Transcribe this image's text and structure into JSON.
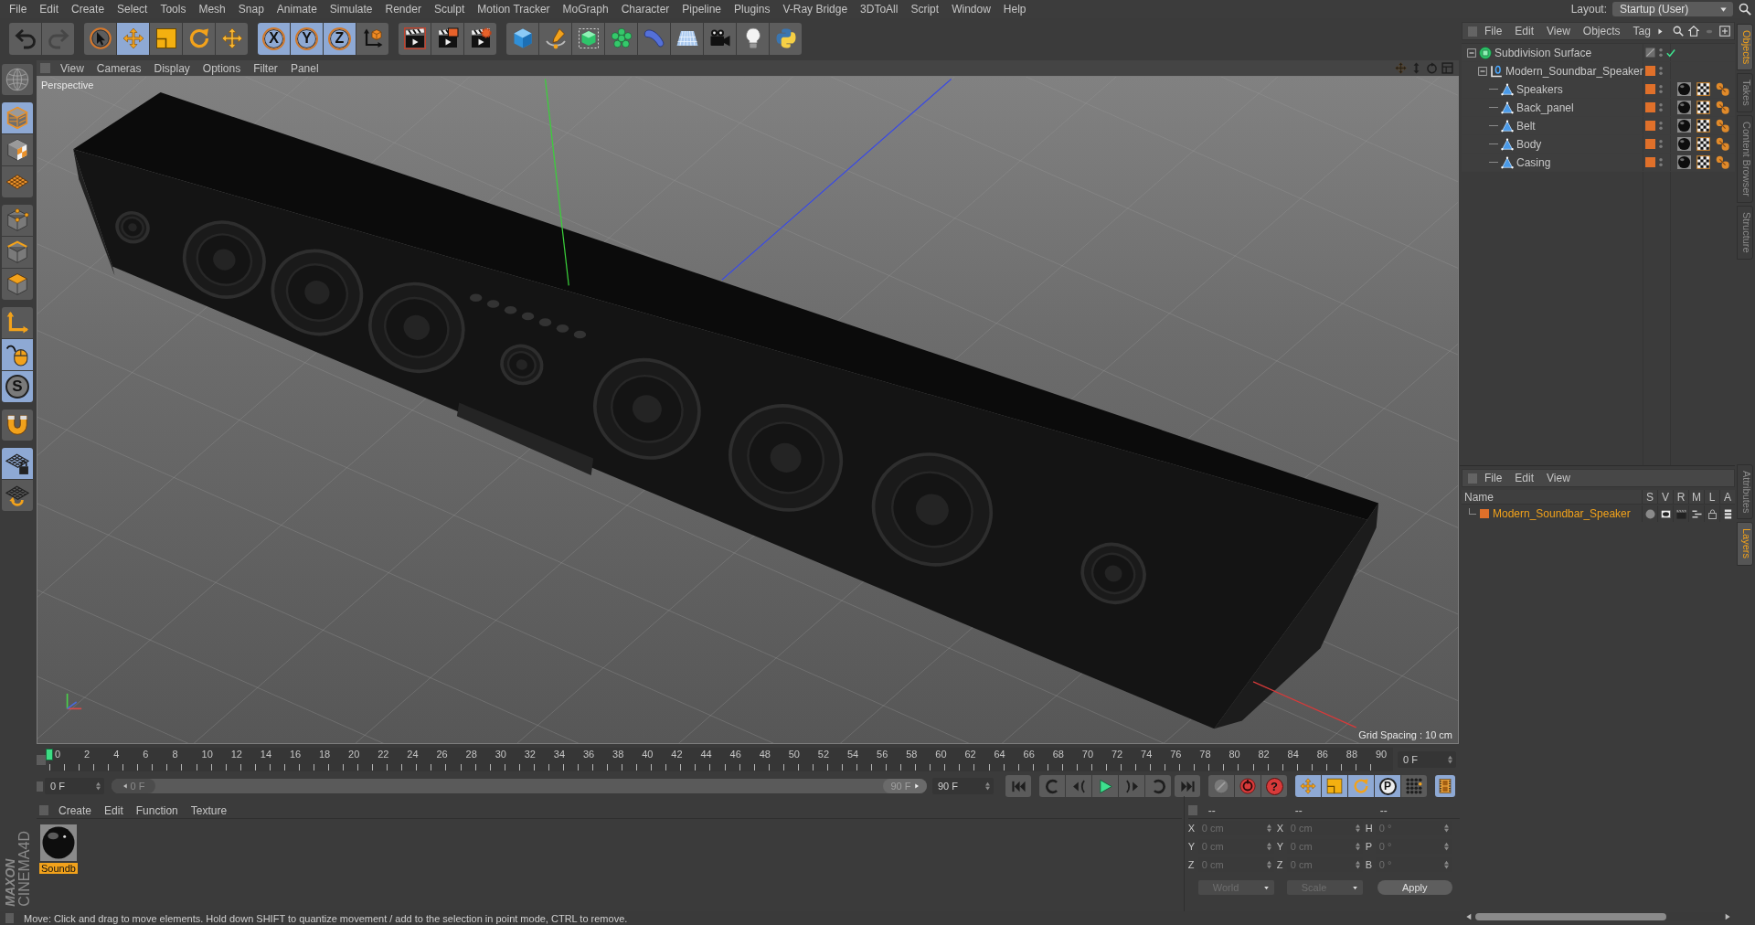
{
  "menu_bar": {
    "items": [
      "File",
      "Edit",
      "Create",
      "Select",
      "Tools",
      "Mesh",
      "Snap",
      "Animate",
      "Simulate",
      "Render",
      "Sculpt",
      "Motion Tracker",
      "MoGraph",
      "Character",
      "Pipeline",
      "Plugins",
      "V-Ray Bridge",
      "3DToAll",
      "Script",
      "Window",
      "Help"
    ],
    "layout_label": "Layout:",
    "layout_value": "Startup (User)"
  },
  "main_toolbar": [
    [
      {
        "kind": "undo",
        "disabled": false
      },
      {
        "kind": "redo",
        "disabled": true
      }
    ],
    [
      {
        "kind": "select",
        "active": false
      },
      {
        "kind": "move",
        "active": true
      },
      {
        "kind": "scale",
        "active": false
      },
      {
        "kind": "rotate",
        "active": false
      },
      {
        "kind": "recent",
        "active": false
      }
    ],
    [
      {
        "kind": "axis",
        "label": "X",
        "active": true
      },
      {
        "kind": "axis",
        "label": "Y",
        "active": true
      },
      {
        "kind": "axis",
        "label": "Z",
        "active": true
      },
      {
        "kind": "coords",
        "active": false
      }
    ],
    [
      {
        "kind": "render_view"
      },
      {
        "kind": "render_picture"
      },
      {
        "kind": "render_settings"
      }
    ],
    [
      {
        "kind": "cube"
      },
      {
        "kind": "pen"
      },
      {
        "kind": "subdivision"
      },
      {
        "kind": "cloner"
      },
      {
        "kind": "deformer"
      },
      {
        "kind": "floor"
      },
      {
        "kind": "camera"
      },
      {
        "kind": "light"
      },
      {
        "kind": "script"
      }
    ]
  ],
  "side_toolbar": [
    [
      {
        "kind": "make_editable",
        "active": false
      }
    ],
    [
      {
        "kind": "model",
        "active": true
      },
      {
        "kind": "texture",
        "active": false
      },
      {
        "kind": "workplane",
        "active": false
      }
    ],
    [
      {
        "kind": "points",
        "active": false
      },
      {
        "kind": "edges",
        "active": false
      },
      {
        "kind": "polygons",
        "active": false
      }
    ],
    [
      {
        "kind": "axis",
        "active": false
      },
      {
        "kind": "tweak",
        "active": true
      },
      {
        "kind": "snap",
        "label": "S",
        "active": true
      }
    ],
    [
      {
        "kind": "magnet",
        "active": false
      }
    ],
    [
      {
        "kind": "grid_lock",
        "active": true
      },
      {
        "kind": "grid_rotate",
        "active": false
      }
    ]
  ],
  "logo": {
    "brand": "MAXON",
    "product": "CINEMA4D"
  },
  "viewport": {
    "menu": [
      "View",
      "Cameras",
      "Display",
      "Options",
      "Filter",
      "Panel"
    ],
    "camera": "Perspective",
    "grid_spacing": "Grid Spacing : 10 cm"
  },
  "timeline": {
    "frames": [
      "0",
      "2",
      "4",
      "6",
      "8",
      "10",
      "12",
      "14",
      "16",
      "18",
      "20",
      "22",
      "24",
      "26",
      "28",
      "30",
      "32",
      "34",
      "36",
      "38",
      "40",
      "42",
      "44",
      "46",
      "48",
      "50",
      "52",
      "54",
      "56",
      "58",
      "60",
      "62",
      "64",
      "66",
      "68",
      "70",
      "72",
      "74",
      "76",
      "78",
      "80",
      "82",
      "84",
      "86",
      "88",
      "90"
    ],
    "playhead": {
      "level": 0
    },
    "current_frame": "0 F",
    "start_frame": "0 F",
    "range_handles": [
      {
        "label": "0 F",
        "level": 0
      },
      {
        "label": "90 F",
        "level": 1
      }
    ],
    "end_frame": "90 F",
    "playback": [
      [
        {
          "kind": "first"
        }
      ],
      [
        {
          "kind": "prev_key"
        },
        {
          "kind": "prev_frame"
        },
        {
          "kind": "play"
        },
        {
          "kind": "next_frame"
        },
        {
          "kind": "next_key"
        }
      ],
      [
        {
          "kind": "last"
        }
      ]
    ],
    "keys": [
      {
        "kind": "record",
        "disabled": true
      },
      {
        "kind": "autokey",
        "disabled": false
      },
      {
        "kind": "keyset",
        "label": "?",
        "disabled": false
      }
    ],
    "key_filters": [
      {
        "kind": "move",
        "active": true
      },
      {
        "kind": "scale",
        "active": true
      },
      {
        "kind": "rotate",
        "active": true
      },
      {
        "kind": "param",
        "label": "P",
        "active": true
      },
      {
        "kind": "points",
        "active": false
      }
    ],
    "timeline_button": {
      "active": true
    }
  },
  "materials": {
    "menu": [
      "Create",
      "Edit",
      "Function",
      "Texture"
    ],
    "items": [
      {
        "name": "Soundb",
        "selected": true
      }
    ]
  },
  "coordinates": {
    "headers": [
      "--",
      "--",
      "--"
    ],
    "rows": [
      [
        {
          "axis": "X",
          "value": "0 cm"
        },
        {
          "axis": "X",
          "value": "0 cm"
        },
        {
          "axis": "H",
          "value": "0 °"
        }
      ],
      [
        {
          "axis": "Y",
          "value": "0 cm"
        },
        {
          "axis": "Y",
          "value": "0 cm"
        },
        {
          "axis": "P",
          "value": "0 °"
        }
      ],
      [
        {
          "axis": "Z",
          "value": "0 cm"
        },
        {
          "axis": "Z",
          "value": "0 cm"
        },
        {
          "axis": "B",
          "value": "0 °"
        }
      ]
    ],
    "mode": "World",
    "scale_mode": "Scale",
    "apply": "Apply"
  },
  "status_bar": "Move: Click and drag to move elements. Hold down SHIFT to quantize movement / add to the selection in point mode, CTRL to remove.",
  "objects": {
    "menu": [
      "File",
      "Edit",
      "View",
      "Objects",
      "Tag"
    ],
    "tree": [
      {
        "name": "Subdivision Surface",
        "kind": "subdivision",
        "selected": false,
        "layer": false,
        "enabled": true,
        "expanded": true,
        "children": [
          {
            "name": "Modern_Soundbar_Speaker",
            "kind": "null",
            "selected": false,
            "layer": true,
            "expanded": true,
            "children": [
              {
                "name": "Speakers",
                "kind": "polygon",
                "selected": false,
                "layer": true,
                "tags": [
                  {
                    "kind": "material"
                  },
                  {
                    "kind": "texture"
                  },
                  {
                    "kind": "phong"
                  }
                ]
              },
              {
                "name": "Back_panel",
                "kind": "polygon",
                "selected": false,
                "layer": true,
                "tags": [
                  {
                    "kind": "material"
                  },
                  {
                    "kind": "texture"
                  },
                  {
                    "kind": "phong"
                  }
                ]
              },
              {
                "name": "Belt",
                "kind": "polygon",
                "selected": false,
                "layer": true,
                "tags": [
                  {
                    "kind": "material"
                  },
                  {
                    "kind": "texture"
                  },
                  {
                    "kind": "phong"
                  }
                ]
              },
              {
                "name": "Body",
                "kind": "polygon",
                "selected": false,
                "layer": true,
                "tags": [
                  {
                    "kind": "material"
                  },
                  {
                    "kind": "texture"
                  },
                  {
                    "kind": "phong"
                  }
                ]
              },
              {
                "name": "Casing",
                "kind": "polygon",
                "selected": false,
                "layer": true,
                "tags": [
                  {
                    "kind": "material"
                  },
                  {
                    "kind": "texture"
                  },
                  {
                    "kind": "phong"
                  }
                ]
              }
            ]
          }
        ]
      }
    ]
  },
  "side_tabs": {
    "top": [
      {
        "label": "Objects",
        "selected": true
      },
      {
        "label": "Takes",
        "selected": false
      },
      {
        "label": "Content Browser",
        "selected": false
      },
      {
        "label": "Structure",
        "selected": false
      }
    ],
    "bottom": [
      {
        "label": "Attributes",
        "selected": false
      },
      {
        "label": "Layers",
        "selected": true
      }
    ]
  },
  "layers": {
    "menu": [
      "File",
      "Edit",
      "View"
    ],
    "columns": [
      "Name",
      "S",
      "V",
      "R",
      "M",
      "L",
      "A"
    ],
    "rows": [
      {
        "name": "Modern_Soundbar_Speaker",
        "color": "#e0702a",
        "selected": true
      }
    ]
  }
}
